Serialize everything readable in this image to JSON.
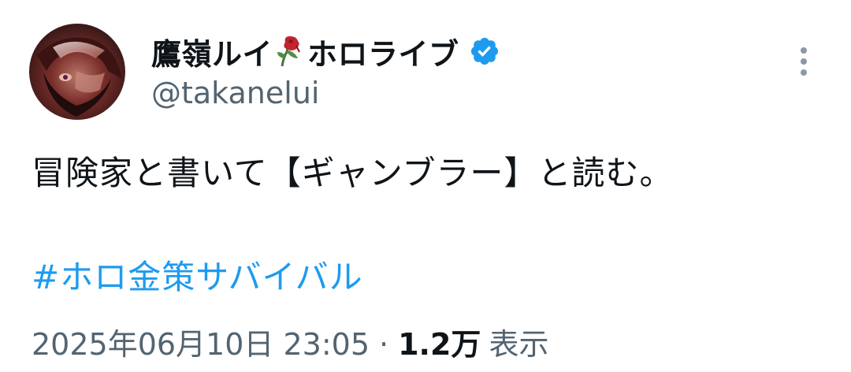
{
  "author": {
    "display_name": "鷹嶺ルイ",
    "display_name_suffix": "ホロライブ",
    "handle": "@takanelui",
    "verified": true
  },
  "tweet": {
    "text": "冒険家と書いて【ギャンブラー】と読む。",
    "hashtag": "#ホロ金策サバイバル"
  },
  "meta": {
    "timestamp": "2025年06月10日 23:05",
    "separator": "·",
    "views_count": "1.2万",
    "views_label": "表示"
  },
  "icons": {
    "avatar": "avatar-image",
    "rose": "wilted-rose-icon",
    "verified": "verified-badge-icon",
    "more": "more-options-icon"
  },
  "colors": {
    "text": "#0f1419",
    "secondary": "#536471",
    "accent": "#1d9bf0"
  }
}
